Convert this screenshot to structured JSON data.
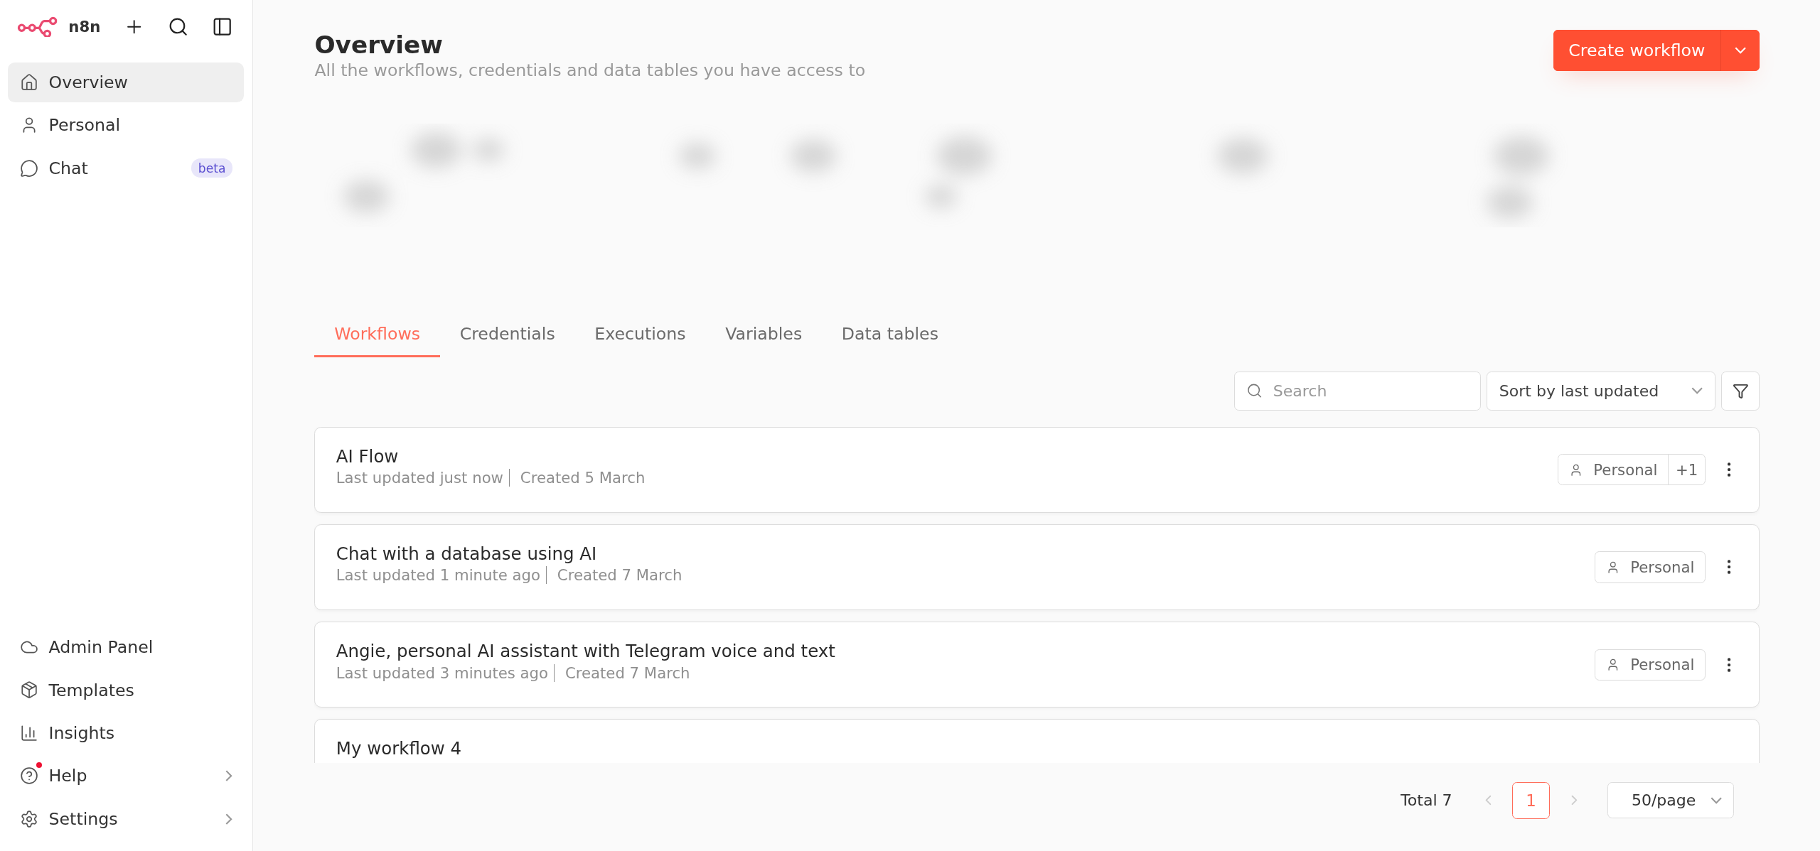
{
  "sidebar": {
    "brand": "n8n",
    "top_items": [
      {
        "label": "Overview",
        "selected": true
      },
      {
        "label": "Personal",
        "selected": false
      },
      {
        "label": "Chat",
        "selected": false,
        "badge": "beta"
      }
    ],
    "bottom_items": [
      {
        "label": "Admin Panel",
        "selected": false
      },
      {
        "label": "Templates",
        "selected": false
      },
      {
        "label": "Insights",
        "selected": false
      },
      {
        "label": "Help",
        "selected": false,
        "submenu": true,
        "notification": true
      },
      {
        "label": "Settings",
        "selected": false,
        "submenu": true
      }
    ]
  },
  "header": {
    "title": "Overview",
    "subtitle": "All the workflows, credentials and data tables you have access to",
    "create_button": "Create workflow"
  },
  "tabs": [
    {
      "label": "Workflows",
      "selected": true
    },
    {
      "label": "Credentials",
      "selected": false
    },
    {
      "label": "Executions",
      "selected": false
    },
    {
      "label": "Variables",
      "selected": false
    },
    {
      "label": "Data tables",
      "selected": false
    }
  ],
  "search": {
    "placeholder": "Search"
  },
  "sort": {
    "value": "Sort by last updated"
  },
  "workflows": [
    {
      "name": "AI Flow",
      "updated": "Last updated just now",
      "created": "Created 5 March",
      "owner": "Personal",
      "extra": "+1"
    },
    {
      "name": "Chat with a database using AI",
      "updated": "Last updated 1 minute ago",
      "created": "Created 7 March",
      "owner": "Personal"
    },
    {
      "name": "Angie, personal AI assistant with Telegram voice and text",
      "updated": "Last updated 3 minutes ago",
      "created": "Created 7 March",
      "owner": "Personal"
    },
    {
      "name": "My workflow 4"
    }
  ],
  "pagination": {
    "total": "Total 7",
    "pages": [
      {
        "label": "1",
        "selected": true
      }
    ],
    "page_size": "50/page"
  }
}
